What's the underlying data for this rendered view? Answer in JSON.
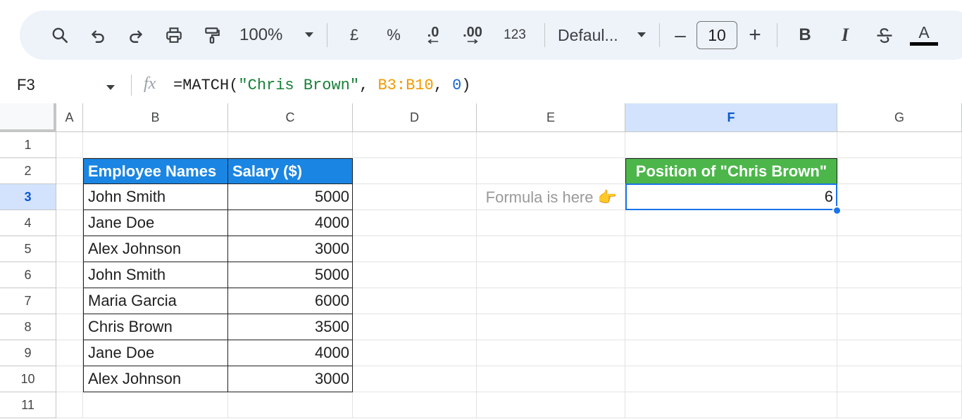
{
  "toolbar": {
    "zoom": "100%",
    "currency": "£",
    "percent": "%",
    "decrease_decimal": ".0",
    "increase_decimal": ".00",
    "number_format": "123",
    "font_name": "Defaul...",
    "font_size": "10",
    "minus": "–",
    "plus": "+",
    "bold": "B",
    "italic": "I",
    "text_color": "A"
  },
  "formula_bar": {
    "cell_ref": "F3",
    "fx": "fx",
    "formula_prefix": "=MATCH(",
    "formula_string": "\"Chris Brown\"",
    "formula_sep1": ", ",
    "formula_range": "B3:B10",
    "formula_sep2": ", ",
    "formula_num": "0",
    "formula_suffix": ")"
  },
  "columns": [
    "A",
    "B",
    "C",
    "D",
    "E",
    "F",
    "G"
  ],
  "rows": [
    "1",
    "2",
    "3",
    "4",
    "5",
    "6",
    "7",
    "8",
    "9",
    "10",
    "11"
  ],
  "table": {
    "header_names": "Employee Names",
    "header_salary": "Salary ($)",
    "rows": [
      {
        "name": "John Smith",
        "salary": "5000"
      },
      {
        "name": "Jane Doe",
        "salary": "4000"
      },
      {
        "name": "Alex Johnson",
        "salary": "3000"
      },
      {
        "name": "John Smith",
        "salary": "5000"
      },
      {
        "name": "Maria Garcia",
        "salary": "6000"
      },
      {
        "name": "Chris Brown",
        "salary": "3500"
      },
      {
        "name": "Jane Doe",
        "salary": "4000"
      },
      {
        "name": "Alex Johnson",
        "salary": "3000"
      }
    ]
  },
  "result": {
    "header": "Position of \"Chris Brown\"",
    "value": "6",
    "note": "Formula is here 👉"
  },
  "colors": {
    "header_blue": "#1a85e3",
    "header_green": "#4cb64a",
    "selection": "#1a73e8"
  }
}
